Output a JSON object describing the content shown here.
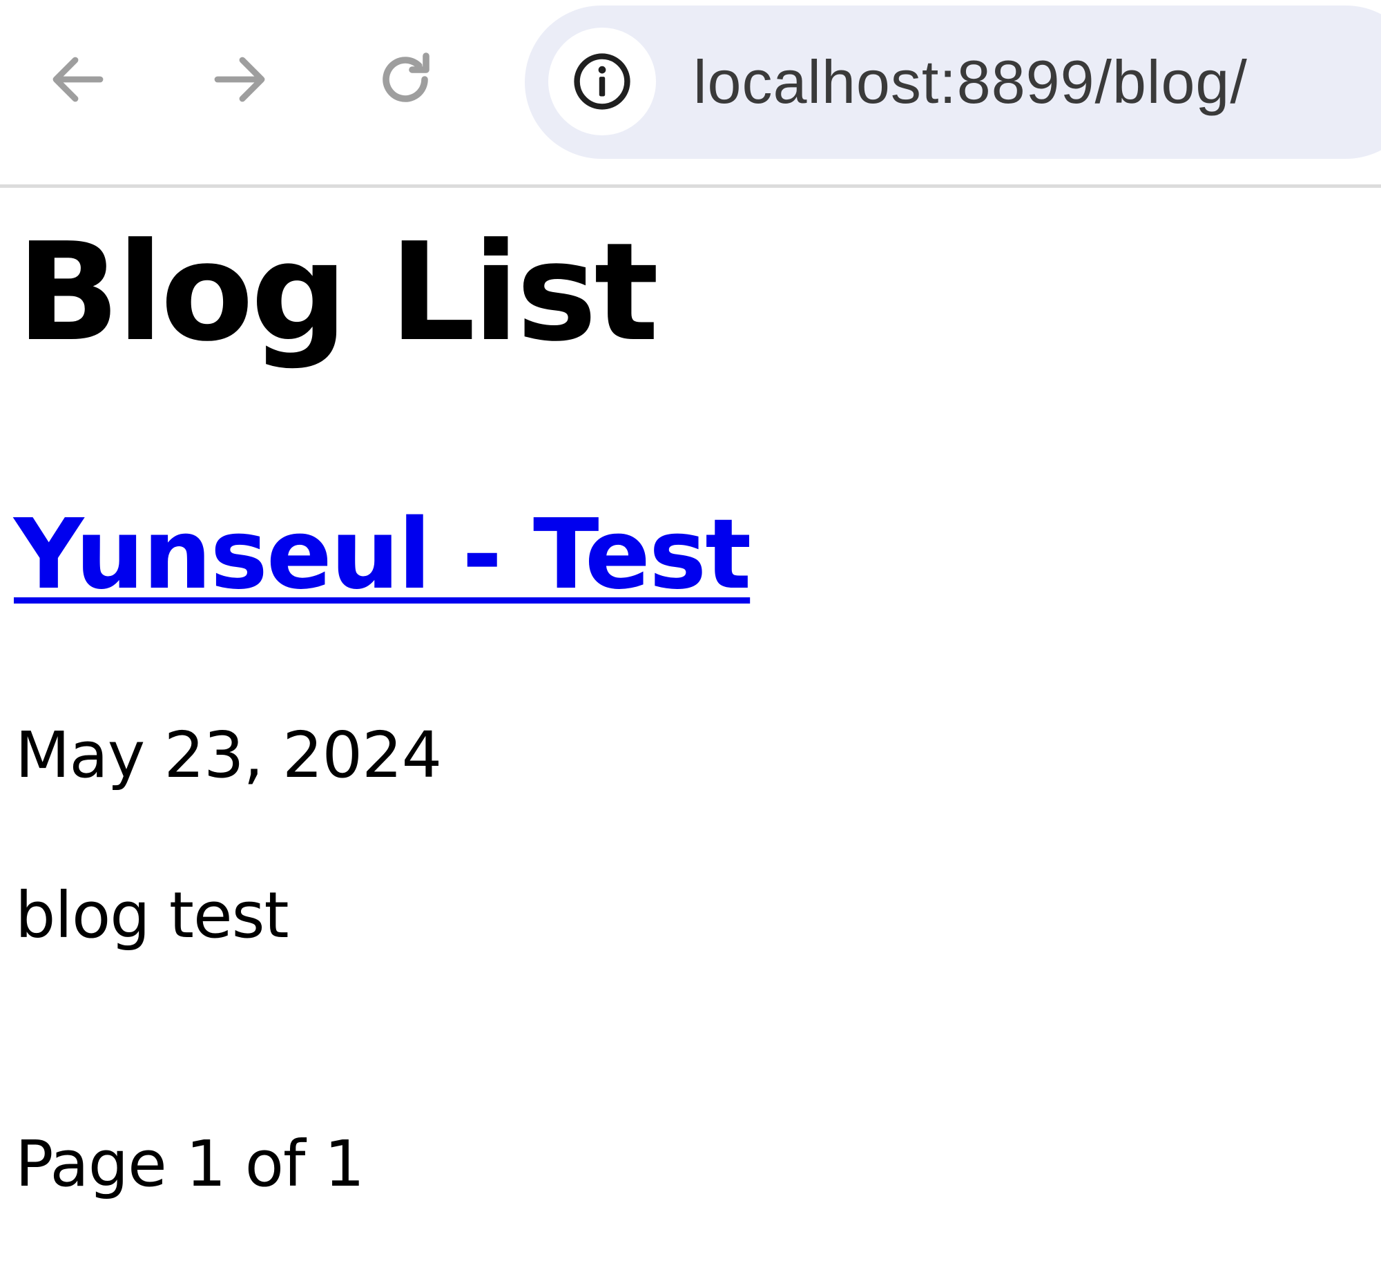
{
  "browser": {
    "url": "localhost:8899/blog/",
    "icons": {
      "back": "back-arrow-icon",
      "forward": "forward-arrow-icon",
      "reload": "reload-icon",
      "site_info": "info-icon"
    },
    "colors": {
      "omnibox_bg": "#ebedf7",
      "nav_icon": "#9e9e9e"
    }
  },
  "page": {
    "title": "Blog List",
    "posts": [
      {
        "title": "Yunseul - Test",
        "date": "May 23, 2024",
        "excerpt": "blog test"
      }
    ],
    "pagination": "Page 1 of 1"
  },
  "colors": {
    "link": "#0000ee",
    "text": "#000000"
  }
}
